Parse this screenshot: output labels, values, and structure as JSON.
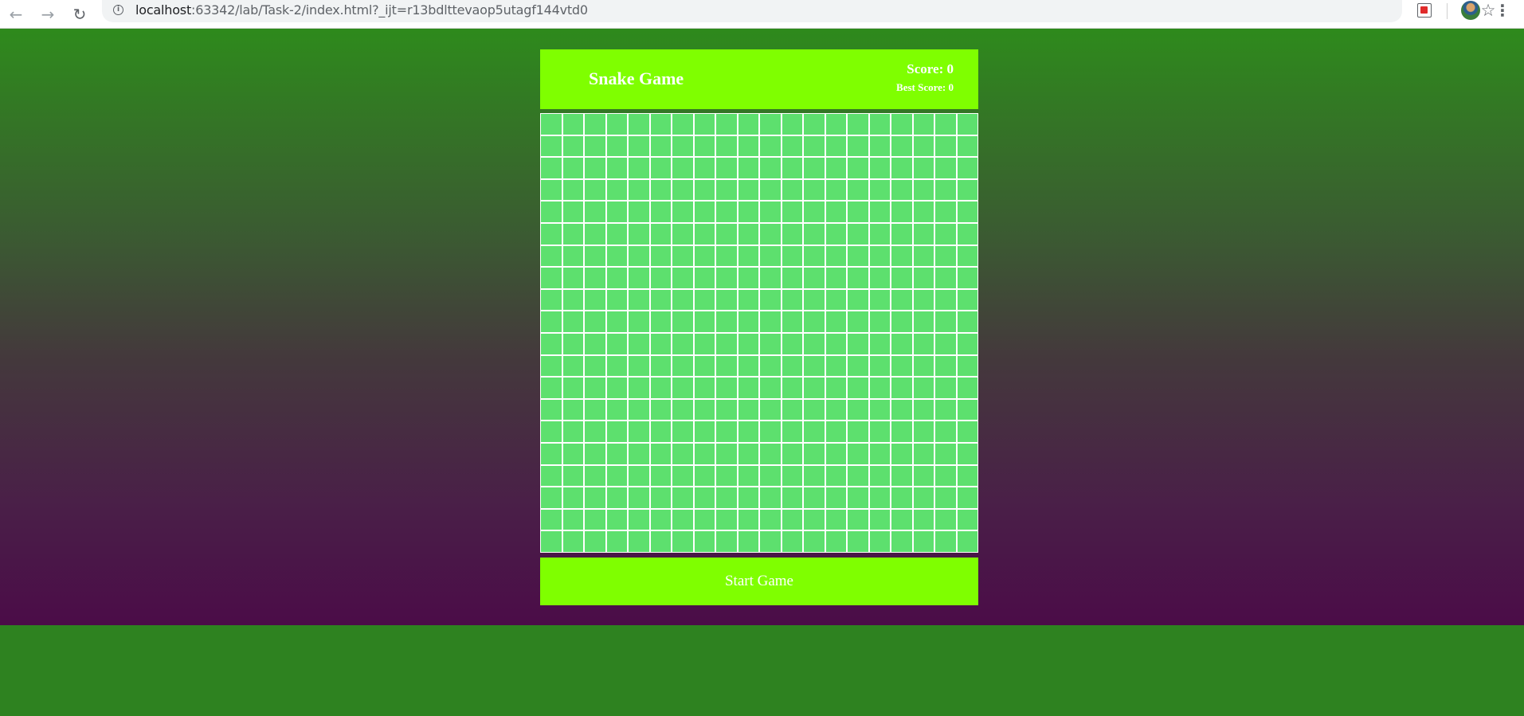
{
  "browser": {
    "url_host": "localhost",
    "url_rest": ":63342/lab/Task-2/index.html?_ijt=r13bdlttevaop5utagf144vtd0",
    "back_icon": "←",
    "forward_icon": "→",
    "reload_icon": "↻",
    "info_icon": "i",
    "star_icon": "☆",
    "menu_icon": "⋮"
  },
  "game": {
    "title": "Snake Game",
    "score_text": "Score: 0",
    "best_score_text": "Best Score: 0",
    "start_button_label": "Start Game",
    "grid_columns": 20,
    "grid_rows": 20
  },
  "colors": {
    "panel": "#7fff00",
    "cell": "#5de06e",
    "grid_line": "#ffffff",
    "text": "#ffffff",
    "gradient_top": "#2e8a1c",
    "gradient_bottom": "#4b0c48"
  }
}
